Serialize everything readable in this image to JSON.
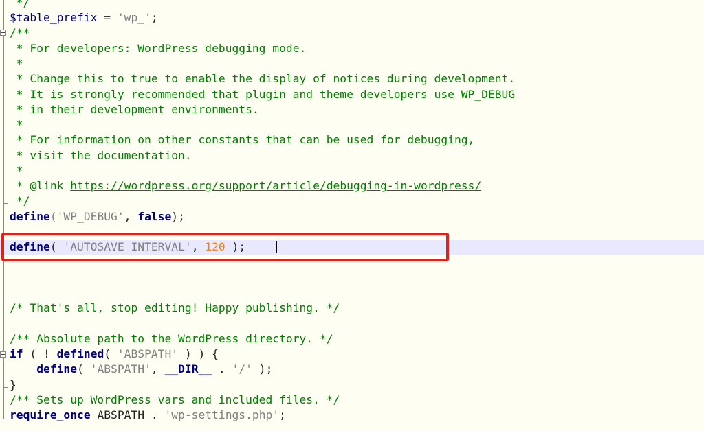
{
  "editor": {
    "lines": [
      " */",
      "$table_prefix = 'wp_';",
      "/**",
      " * For developers: WordPress debugging mode.",
      " *",
      " * Change this to true to enable the display of notices during development.",
      " * It is strongly recommended that plugin and theme developers use WP_DEBUG",
      " * in their development environments.",
      " *",
      " * For information on other constants that can be used for debugging,",
      " * visit the documentation.",
      " *",
      " * @link ",
      "https://wordpress.org/support/article/debugging-in-wordpress/",
      " */",
      "define",
      "('WP_DEBUG'",
      ", ",
      "false",
      ");",
      "define",
      "( ",
      "'AUTOSAVE_INTERVAL'",
      ", ",
      "120",
      " );",
      "/* That's all, stop editing! Happy publishing. */",
      "/** Absolute path to the WordPress directory. */",
      "if",
      " ( ! ",
      "defined",
      "( ",
      "'ABSPATH'",
      " ) ) {",
      "    ",
      "define",
      "( ",
      "'ABSPATH'",
      ", ",
      "__DIR__",
      " . ",
      "'/'",
      " );",
      "}",
      "/** Sets up WordPress vars and included files. */",
      "require_once",
      " ABSPATH . ",
      "'wp-settings.php'",
      ";"
    ],
    "tokens": {
      "table_var": "$table_prefix",
      "table_eq": " = ",
      "table_val": "'wp_'",
      "table_semi": ";"
    }
  },
  "colors": {
    "background": "#fffef2",
    "comment": "#008000",
    "keyword": "#000080",
    "string": "#808080",
    "number": "#ff8000",
    "highlight_border": "#e0201b",
    "current_line": "#e8e8ff"
  }
}
